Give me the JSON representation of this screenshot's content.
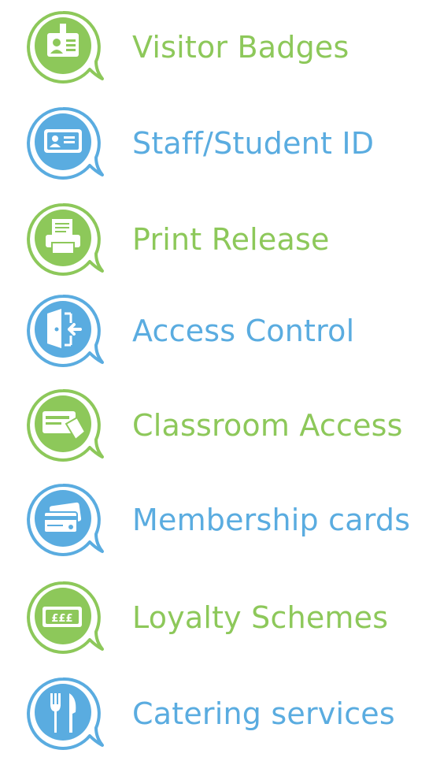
{
  "colors": {
    "green": "#8DC85A",
    "blue": "#5AACE0"
  },
  "items": [
    {
      "label": "Visitor Badges",
      "icon": "visitor-badge-icon",
      "color": "green"
    },
    {
      "label": "Staff/Student ID",
      "icon": "id-card-icon",
      "color": "blue"
    },
    {
      "label": "Print Release",
      "icon": "printer-icon",
      "color": "green"
    },
    {
      "label": "Access Control",
      "icon": "door-entry-icon",
      "color": "blue"
    },
    {
      "label": "Classroom Access",
      "icon": "card-reader-icon",
      "color": "green"
    },
    {
      "label": "Membership cards",
      "icon": "credit-cards-icon",
      "color": "blue"
    },
    {
      "label": "Loyalty Schemes",
      "icon": "pound-card-icon",
      "color": "green"
    },
    {
      "label": "Catering services",
      "icon": "fork-knife-icon",
      "color": "blue"
    }
  ]
}
